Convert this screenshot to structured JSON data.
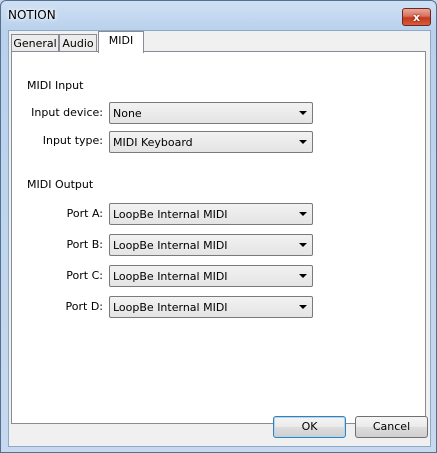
{
  "window": {
    "title": "NOTION",
    "close_symbol": "x"
  },
  "tabs": [
    {
      "label": "General"
    },
    {
      "label": "Audio"
    },
    {
      "label": "MIDI",
      "active": true
    }
  ],
  "midi_input": {
    "heading": "MIDI Input",
    "device": {
      "label": "Input device:",
      "value": "None"
    },
    "type": {
      "label": "Input type:",
      "value": "MIDI Keyboard"
    }
  },
  "midi_output": {
    "heading": "MIDI Output",
    "ports": [
      {
        "label": "Port A:",
        "value": "LoopBe Internal MIDI"
      },
      {
        "label": "Port B:",
        "value": "LoopBe Internal MIDI"
      },
      {
        "label": "Port C:",
        "value": "LoopBe Internal MIDI"
      },
      {
        "label": "Port D:",
        "value": "LoopBe Internal MIDI"
      }
    ]
  },
  "buttons": {
    "ok": "OK",
    "cancel": "Cancel"
  },
  "colors": {
    "close_button": "#c53a1f",
    "default_button_border": "#3c7fb1"
  }
}
